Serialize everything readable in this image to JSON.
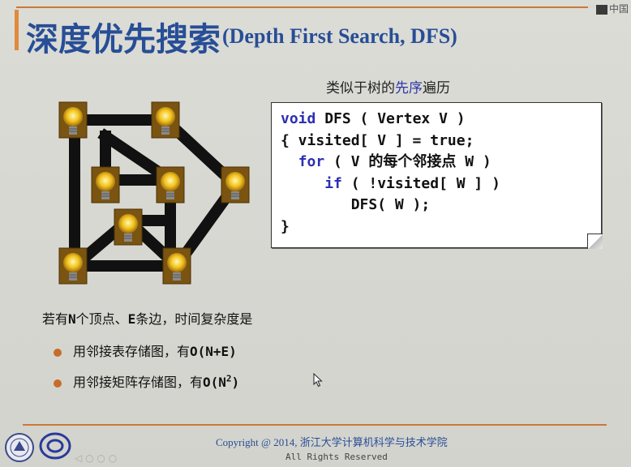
{
  "window": {
    "lang_label": "中国"
  },
  "slide": {
    "title_zh": "深度优先搜索",
    "title_en": "(Depth First Search, DFS)",
    "subtitle_pre": "类似于树的",
    "subtitle_hl": "先序",
    "subtitle_post": "遍历",
    "code": {
      "l1_kw": "void",
      "l1_rest": " DFS ( Vertex V )",
      "l2": "{ visited[ V ] = true;",
      "l3_kw": "for",
      "l3_rest": " ( V 的每个邻接点 W )",
      "l4_kw": "if",
      "l4_rest": " ( !visited[ W ] )",
      "l5": "DFS( W );",
      "l6": "}"
    },
    "problem_pre": "若有",
    "problem_n": "N",
    "problem_mid": "个顶点、",
    "problem_e": "E",
    "problem_post": "条边，时间复杂度是",
    "bullet1_text": "用邻接表存储图，有",
    "bullet1_complexity": "O(N+E)",
    "bullet2_text": "用邻接矩阵存储图，有",
    "bullet2_complexity": "O(N",
    "bullet2_sup": "2",
    "bullet2_close": ")",
    "copyright": "Copyright @ 2014, 浙江大学计算机科学与技术学院",
    "rights": "All Rights Reserved"
  },
  "colors": {
    "title": "#274e96",
    "keyword": "#2d2fb3",
    "accent": "#c87a3a",
    "bullet": "#c76d28"
  },
  "icons": [
    "lightbulb-icon",
    "mouse-cursor-icon",
    "university-seal-icon",
    "college-logo-icon"
  ]
}
